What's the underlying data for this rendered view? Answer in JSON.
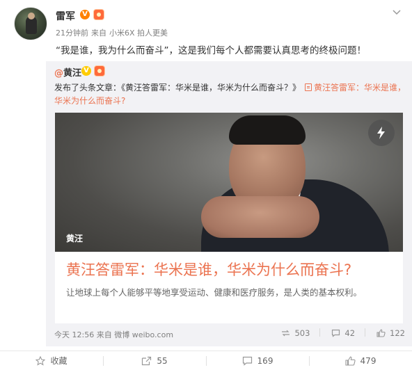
{
  "post": {
    "author": "雷军",
    "verified_badge": "V",
    "meta": {
      "time": "21分钟前",
      "source_prefix": "来自",
      "source": "小米6X 拍人更美"
    },
    "text": "“我是谁，我为什么而奋斗”，这是我们每个人都需要认真思考的终极问题！"
  },
  "repost": {
    "author_prefix": "@",
    "author": "黄汪",
    "verified_badge": "V",
    "text_prefix": "发布了头条文章：",
    "article_ref": "《黄汪答雷军：华米是谁，华米为什么而奋斗？》",
    "link_text": "黄汪答雷军：华米是谁，华米为什么而奋斗?",
    "card": {
      "author_tag": "黄汪",
      "title": "黄汪答雷军：华米是谁，华米为什么而奋斗?",
      "summary": "让地球上每个人能够平等地享受运动、健康和医疗服务，是人类的基本权利。"
    },
    "footer": {
      "time": "今天 12:56",
      "source_prefix": "来自",
      "source": "微博 weibo.com"
    },
    "stats": {
      "reposts": "503",
      "comments": "42",
      "likes": "122"
    }
  },
  "actions": {
    "favorite": "收藏",
    "repost": "55",
    "comment": "169",
    "like": "479"
  },
  "colors": {
    "accent": "#eb7350",
    "vip_orange": "#ff8200",
    "repost_bg": "#f2f2f5"
  }
}
